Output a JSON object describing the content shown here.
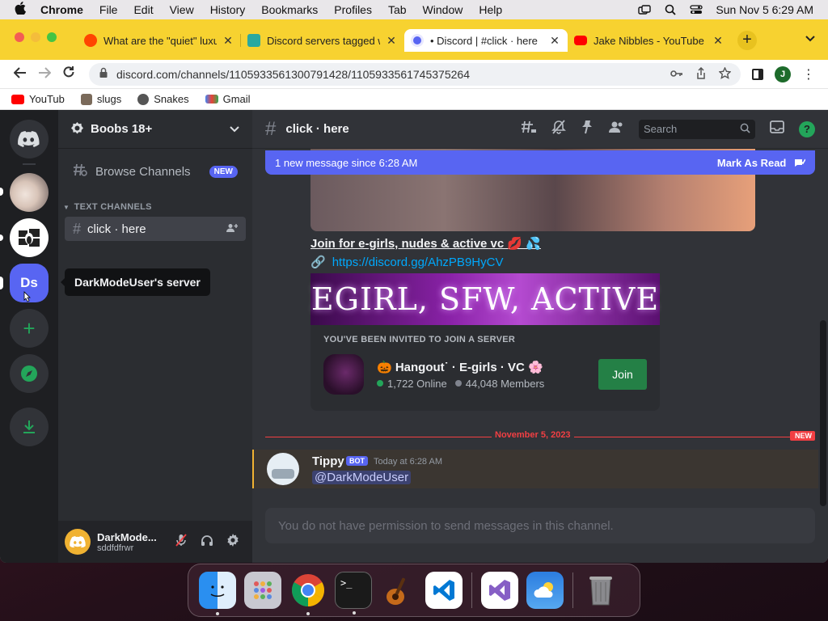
{
  "menubar": {
    "app": "Chrome",
    "items": [
      "File",
      "Edit",
      "View",
      "History",
      "Bookmarks",
      "Profiles",
      "Tab",
      "Window",
      "Help"
    ],
    "clock": "Sun Nov 5  6:29 AM"
  },
  "tabs": [
    {
      "title": "What are the \"quiet\" luxury",
      "favicon_color": "#ff4500",
      "active": false
    },
    {
      "title": "Discord servers tagged with",
      "favicon_color": "#2aa9a0",
      "active": false
    },
    {
      "title": "• Discord | #click · here",
      "favicon_color": "#5865f2",
      "active": true
    },
    {
      "title": "Jake Nibbles - YouTube",
      "favicon_color": "#ff0000",
      "active": false
    }
  ],
  "toolbar": {
    "url": "discord.com/channels/1105933561300791428/1105933561745375264",
    "profile_letter": "J"
  },
  "bookmarks": [
    {
      "label": "YouTub",
      "color": "#ff0000"
    },
    {
      "label": "slugs",
      "color": "#7a6a5a"
    },
    {
      "label": "Snakes",
      "color": "#555555"
    },
    {
      "label": "Gmail",
      "color": "#ea4335"
    }
  ],
  "servers": {
    "ds_label": "Ds",
    "tooltip": "DarkModeUser's server"
  },
  "guild": {
    "name": "Boobs 18+",
    "browse_label": "Browse Channels",
    "new_badge": "NEW",
    "category": "TEXT CHANNELS",
    "channel": "click · here"
  },
  "user": {
    "name": "DarkMode...",
    "tag": "sddfdfrwr"
  },
  "chat": {
    "channel_name": "click · here",
    "search_placeholder": "Search",
    "new_message_text": "1 new message since 6:28 AM",
    "mark_as_read": "Mark As Read",
    "embed_title": "Join for e-girls, nudes & active vc 💋 💦",
    "embed_link": "https://discord.gg/AhzPB9HyCV",
    "banner_text": "EGIRL, SFW, ACTIVE",
    "invite_heading": "YOU'VE BEEN INVITED TO JOIN A SERVER",
    "invite_server": "🎃 Hangout˙ · E-girls  · VC 🌸",
    "invite_online": "1,722 Online",
    "invite_members": "44,048 Members",
    "join_label": "Join",
    "divider_date": "November 5, 2023",
    "divider_new": "NEW",
    "msg_author": "Tippy",
    "msg_bot_tag": "BOT",
    "msg_time": "Today at 6:28 AM",
    "msg_mention": "@DarkModeUser",
    "composer_text": "You do not have permission to send messages in this channel."
  },
  "colors": {
    "blurple": "#5865f2",
    "discord_green": "#23a55a",
    "mention_red": "#f23f43",
    "chrome_tab_yellow": "#f7d230"
  },
  "dock": [
    "finder-icon",
    "launchpad-icon",
    "chrome-icon",
    "terminal-icon",
    "garageband-icon",
    "vscode-icon",
    "visual-studio-icon",
    "weather-icon",
    "trash-icon"
  ]
}
